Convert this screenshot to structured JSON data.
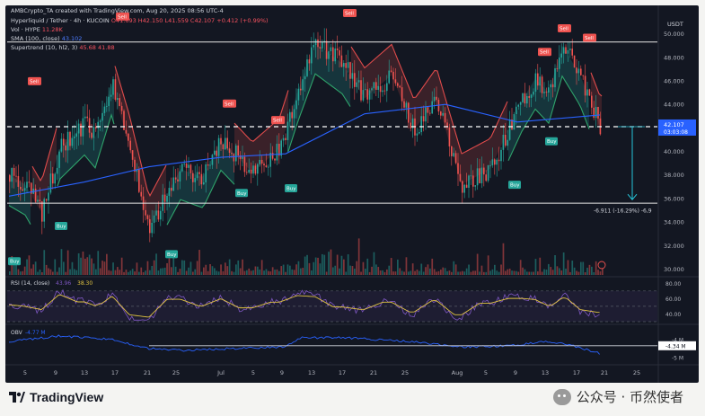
{
  "header": {
    "credit": "AMBCrypto_TA created with TradingView.com, Aug 20, 2025 08:56 UTC-4",
    "symbol_line": "Hyperliquid / Tether · 4h · KUCOIN",
    "ohlc": "O41.693 H42.150 L41.559 C42.107 +0.412 (+0.99%)",
    "vol_label": "Vol · HYPE",
    "vol_value": "11.28K",
    "sma_label": "SMA (100, close)",
    "sma_value": "43.102",
    "st_label": "Supertrend (10, hl2, 3)",
    "st_value": "45.68  41.88",
    "currency": "USDT"
  },
  "price_axis": [
    "50.000",
    "48.000",
    "46.000",
    "44.000",
    "42.000",
    "40.000",
    "38.000",
    "36.000",
    "34.000",
    "32.000",
    "30.000"
  ],
  "current_price": {
    "value": "42.107",
    "countdown": "03:03:08"
  },
  "measure_label": "-6.911 (-16.29%) -6,9",
  "signals": {
    "sell": "Sell",
    "buy": "Buy"
  },
  "rsi": {
    "label": "RSI (14, close)",
    "value1": "43.96",
    "value2": "38.30",
    "axis": [
      "80.00",
      "60.00",
      "40.00"
    ]
  },
  "obv": {
    "label": "OBV",
    "value": "-4.77 M",
    "axis": [
      "-4 M",
      "-4.34 M",
      "-5 M"
    ]
  },
  "time_axis": [
    "5",
    "9",
    "13",
    "17",
    "21",
    "25",
    "Jul",
    "5",
    "9",
    "13",
    "17",
    "21",
    "25",
    "Aug",
    "5",
    "9",
    "13",
    "17",
    "21",
    "25"
  ],
  "brand": "TradingView",
  "watermark": "公众号 · 币然使者",
  "colors": {
    "bg": "#131722",
    "up": "#26a69a",
    "down": "#ef5350",
    "sma": "#2962ff",
    "rsi": "#e0c341",
    "obv": "#2962ff",
    "sell_bg": "#ef5350",
    "buy_bg": "#26a69a"
  },
  "chart_data": {
    "type": "line",
    "series": [
      {
        "name": "Hyperliquid / Tether",
        "x": [
          "Jun 3",
          "Jun 5",
          "Jun 8",
          "Jun 10",
          "Jun 13",
          "Jun 15",
          "Jun 17",
          "Jun 19",
          "Jun 21",
          "Jun 24",
          "Jun 28",
          "Jul 2",
          "Jul 5",
          "Jul 8",
          "Jul 11",
          "Jul 14",
          "Jul 17",
          "Jul 20",
          "Jul 23",
          "Jul 27",
          "Jul 31",
          "Aug 3",
          "Aug 6",
          "Aug 9",
          "Aug 12",
          "Aug 14",
          "Aug 16",
          "Aug 18",
          "Aug 20"
        ],
        "values": [
          38.0,
          37.2,
          34.8,
          40.2,
          42.3,
          41.2,
          45.7,
          40.5,
          33.5,
          38.5,
          37.8,
          41.0,
          38.2,
          40.2,
          45.0,
          49.2,
          47.5,
          44.5,
          46.5,
          41.8,
          44.5,
          37.2,
          38.5,
          44.3,
          46.2,
          45.0,
          49.0,
          46.5,
          42.107
        ]
      },
      {
        "name": "SMA (100, close)",
        "x": [
          "Jun 3",
          "Jun 13",
          "Jun 21",
          "Jul 1",
          "Jul 10",
          "Jul 20",
          "Aug 1",
          "Aug 10",
          "Aug 20"
        ],
        "values": [
          36.2,
          37.4,
          38.7,
          39.5,
          39.8,
          43.2,
          44.0,
          42.5,
          43.102
        ]
      }
    ],
    "ylim": [
      29.5,
      51.5
    ]
  }
}
